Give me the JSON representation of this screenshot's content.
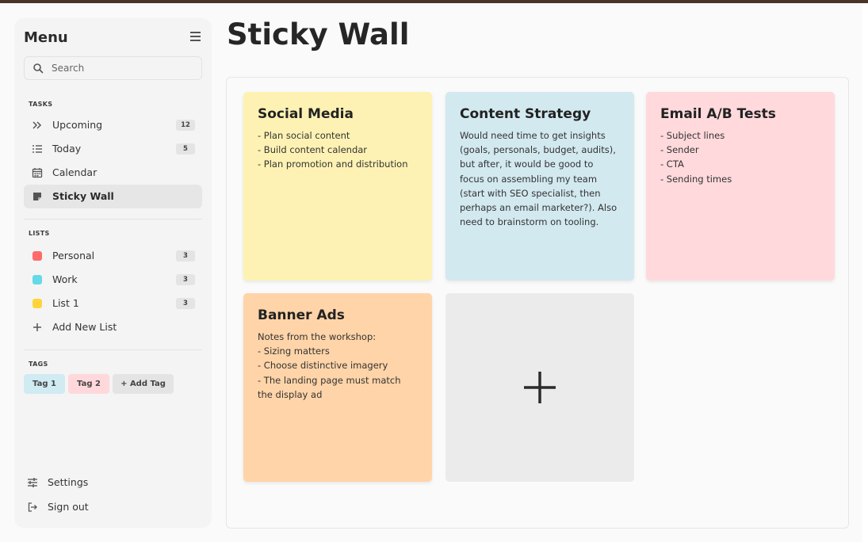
{
  "sidebar": {
    "title": "Menu",
    "search": {
      "placeholder": "Search",
      "value": ""
    },
    "tasks": {
      "label": "TASKS",
      "items": [
        {
          "label": "Upcoming",
          "icon": "double-chevron-right-icon",
          "count": "12"
        },
        {
          "label": "Today",
          "icon": "checklist-icon",
          "count": "5"
        },
        {
          "label": "Calendar",
          "icon": "calendar-icon"
        },
        {
          "label": "Sticky Wall",
          "icon": "sticky-note-icon",
          "active": true
        }
      ]
    },
    "lists": {
      "label": "LISTS",
      "items": [
        {
          "label": "Personal",
          "color": "#ff6b6b",
          "count": "3"
        },
        {
          "label": "Work",
          "color": "#66d9e8",
          "count": "3"
        },
        {
          "label": "List 1",
          "color": "#ffd43b",
          "count": "3"
        }
      ],
      "add_label": "Add New List"
    },
    "tags": {
      "label": "TAGS",
      "items": [
        {
          "label": "Tag 1",
          "color": "#d0ebf1"
        },
        {
          "label": "Tag 2",
          "color": "#ffd8dc"
        }
      ],
      "add_label": "+ Add Tag"
    },
    "footer": {
      "settings_label": "Settings",
      "signout_label": "Sign out"
    }
  },
  "main": {
    "title": "Sticky Wall",
    "notes": [
      {
        "title": "Social Media",
        "body": "- Plan social content\n- Build content calendar\n- Plan promotion and distribution",
        "color": "#fdf2b3"
      },
      {
        "title": "Content Strategy",
        "body": "Would need time to get insights (goals, personals, budget, audits), but after, it would be good to focus on assembling my team (start with SEO specialist, then perhaps an email marketer?). Also need to brainstorm on tooling.",
        "color": "#d2e9ef"
      },
      {
        "title": "Email A/B Tests",
        "body": "- Subject lines\n- Sender\n- CTA\n- Sending times",
        "color": "#ffd9dc"
      },
      {
        "title": "Banner Ads",
        "body": "Notes from the workshop:\n- Sizing matters\n- Choose distinctive imagery\n- The landing page must match the display ad",
        "color": "#ffd4a8"
      }
    ],
    "add_note_icon": "plus-icon"
  },
  "colors": {
    "accent_dark": "#4a3328",
    "sidebar_bg": "#f4f4f4",
    "active_item_bg": "#e6e6e6",
    "add_note_bg": "#ebebeb"
  }
}
